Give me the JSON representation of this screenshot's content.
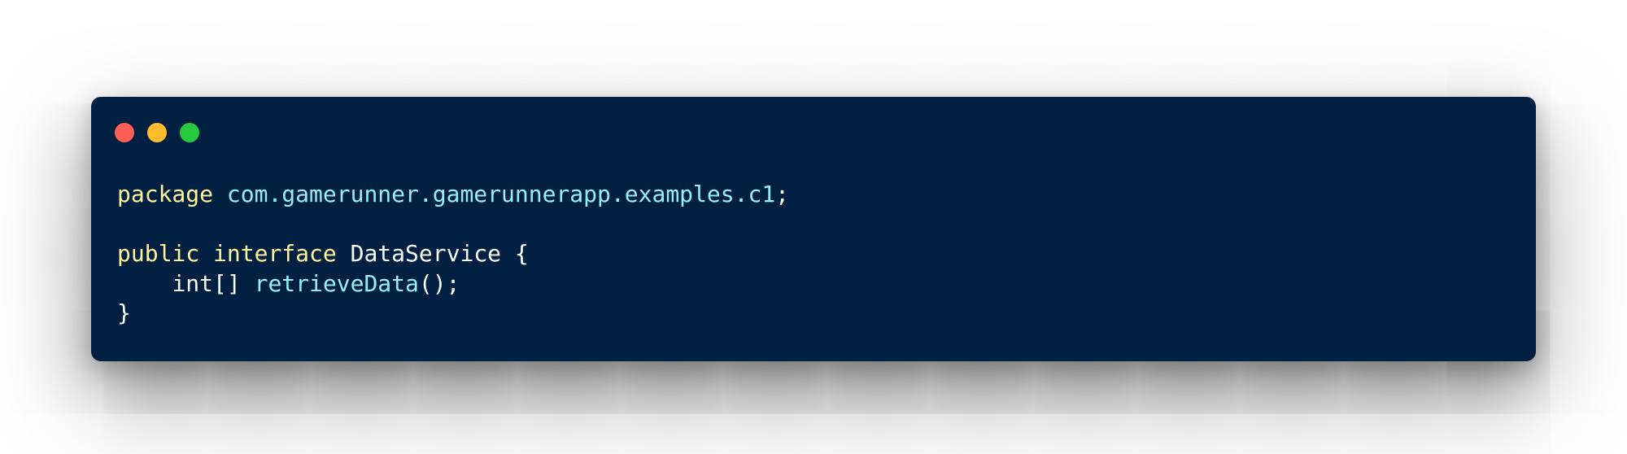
{
  "window": {
    "colors": {
      "background": "#012042",
      "close": "#ff5f56",
      "minimize": "#ffbd2e",
      "maximize": "#27c93f",
      "keyword": "#fff599",
      "identifier": "#96f0f8",
      "text": "#ffffff"
    }
  },
  "code": {
    "line1": {
      "keyword": "package",
      "space": " ",
      "pkg_name": "com.gamerunner.gamerunnerapp.examples.c1",
      "end": ";"
    },
    "line3": {
      "kw_public": "public",
      "space1": " ",
      "kw_interface": "interface",
      "rest": " DataService {"
    },
    "line4": {
      "indent": "    ",
      "type": "int[]",
      "space": " ",
      "method": "retrieveData",
      "end": "();"
    },
    "line5": {
      "brace": "}"
    }
  }
}
